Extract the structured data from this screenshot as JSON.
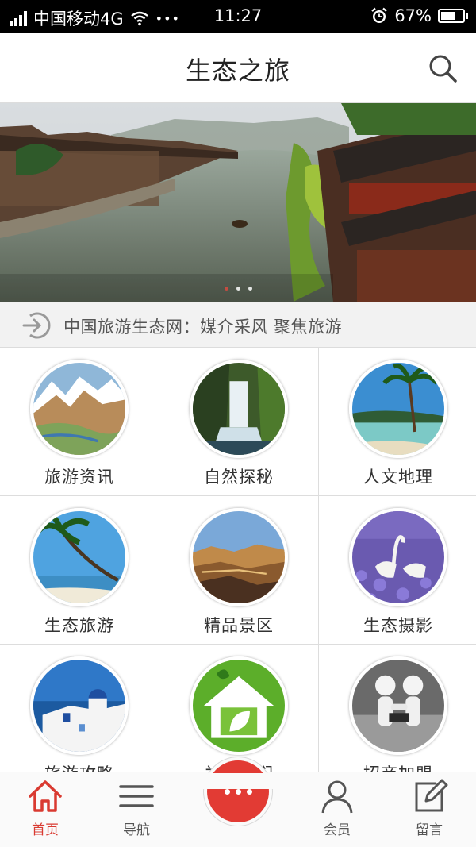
{
  "status_bar": {
    "carrier": "中国移动4G",
    "more": "•••",
    "time": "11:27",
    "battery": "67%",
    "battery_level": 0.67
  },
  "header": {
    "title": "生态之旅",
    "search_icon": "search-icon"
  },
  "banner": {
    "image": "river-town-photo",
    "dots": 3,
    "active_dot": 0
  },
  "notice": {
    "icon": "sign-in-arrow-icon",
    "text": "中国旅游生态网：媒介采风 聚焦旅游"
  },
  "grid": {
    "items": [
      {
        "label": "旅游资讯",
        "image": "map-mountains"
      },
      {
        "label": "自然探秘",
        "image": "waterfall"
      },
      {
        "label": "人文地理",
        "image": "palm-beach"
      },
      {
        "label": "生态旅游",
        "image": "palm-sea"
      },
      {
        "label": "精品景区",
        "image": "canyon"
      },
      {
        "label": "生态摄影",
        "image": "swans-lavender"
      },
      {
        "label": "旅游攻略",
        "image": "santorini"
      },
      {
        "label": "关于我们",
        "image": "green-house"
      },
      {
        "label": "招商加盟",
        "image": "handshake"
      }
    ]
  },
  "tabbar": {
    "items": [
      {
        "label": "首页",
        "icon": "home-icon",
        "active": true
      },
      {
        "label": "导航",
        "icon": "menu-icon",
        "active": false
      },
      {
        "label": "会员",
        "icon": "user-icon",
        "active": false
      },
      {
        "label": "留言",
        "icon": "edit-icon",
        "active": false
      }
    ],
    "center_icon": "more-dots-icon"
  },
  "colors": {
    "accent": "#e23b34",
    "status_bar": "#000000",
    "background": "#ececec"
  }
}
